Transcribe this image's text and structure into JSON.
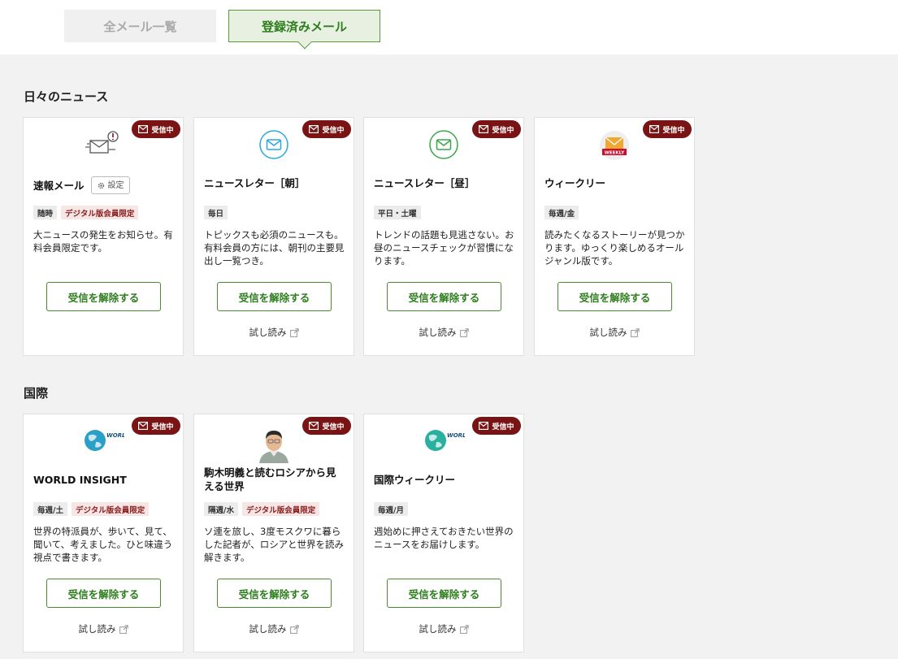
{
  "tabs": {
    "all_label": "全メール一覧",
    "registered_label": "登録済みメール"
  },
  "sections": {
    "daily": {
      "title": "日々のニュース"
    },
    "intl": {
      "title": "国際"
    }
  },
  "common": {
    "badge": "受信中",
    "unsubscribe": "受信を解除する",
    "trial": "試し読み",
    "settings": "設定"
  },
  "cards": [
    {
      "title": "速報メール",
      "tags": [
        "随時",
        "デジタル版会員限定"
      ],
      "desc": "大ニュースの発生をお知らせ。有料会員限定です。",
      "icon": "breaking-mail-icon"
    },
    {
      "title": "ニュースレター［朝］",
      "tags": [
        "毎日"
      ],
      "desc": "トピックスも必須のニュースも。有料会員の方には、朝刊の主要見出し一覧つき。",
      "icon": "envelope-blue-icon"
    },
    {
      "title": "ニュースレター［昼］",
      "tags": [
        "平日・土曜"
      ],
      "desc": "トレンドの話題も見逃さない。お昼のニュースチェックが習慣になります。",
      "icon": "envelope-green-icon"
    },
    {
      "title": "ウィークリー",
      "tags": [
        "毎週/金"
      ],
      "desc": "読みたくなるストーリーが見つかります。ゆっくり楽しめるオールジャンル版です。",
      "icon": "weekly-icon",
      "icon_label": "WEEKLY"
    },
    {
      "title": "WORLD INSIGHT",
      "tags": [
        "毎週/土",
        "デジタル版会員限定"
      ],
      "desc": "世界の特派員が、歩いて、見て、聞いて、考えました。ひと味違う視点で書きます。",
      "icon": "world-insight-logo",
      "icon_label": "WORLD INSIGHT"
    },
    {
      "title": "駒木明義と読むロシアから見える世界",
      "tags": [
        "隔週/水",
        "デジタル版会員限定"
      ],
      "desc": "ソ連を旅し、3度モスクワに暮らした記者が、ロシアと世界を読み解きます。",
      "icon": "author-avatar"
    },
    {
      "title": "国際ウィークリー",
      "tags": [
        "毎週/月"
      ],
      "desc": "週始めに押さえておきたい世界のニュースをお届けします。",
      "icon": "world-weekly-logo",
      "icon_label": "WORLD WEEKLY"
    }
  ],
  "colors": {
    "accent_green": "#2e7d1e",
    "badge_red": "#7a1414",
    "digital_tag": "#8b1a1a"
  }
}
